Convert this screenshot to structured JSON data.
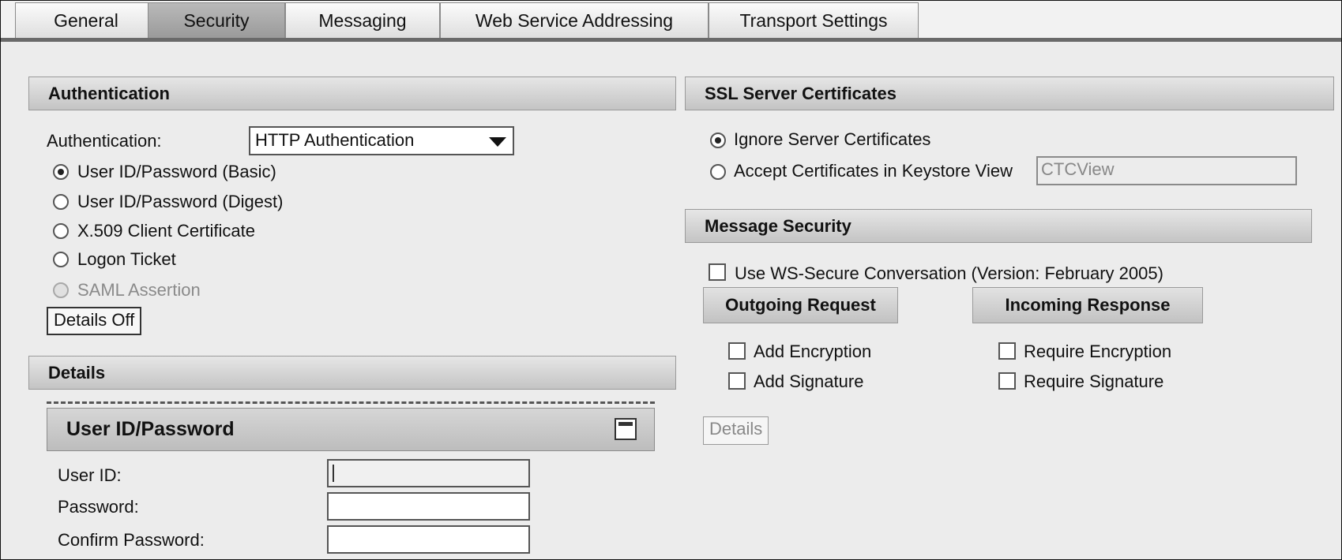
{
  "tabs": [
    "General",
    "Security",
    "Messaging",
    "Web Service Addressing",
    "Transport Settings"
  ],
  "active_tab": "Security",
  "authentication": {
    "section_title": "Authentication",
    "field_label": "Authentication:",
    "selected_value": "HTTP Authentication",
    "options": [
      {
        "label": "User ID/Password (Basic)",
        "checked": true
      },
      {
        "label": "User ID/Password (Digest)",
        "checked": false
      },
      {
        "label": "X.509 Client Certificate",
        "checked": false
      },
      {
        "label": "Logon Ticket",
        "checked": false
      },
      {
        "label": "SAML Assertion",
        "checked": false,
        "disabled": true
      }
    ],
    "details_button": "Details Off"
  },
  "details": {
    "section_title": "Details",
    "tray_title": "User ID/Password",
    "collapse_icon": "collapse-icon",
    "fields": {
      "user_id_label": "User ID:",
      "user_id_value": "",
      "password_label": "Password:",
      "password_value": "",
      "confirm_label": "Confirm Password:",
      "confirm_value": ""
    }
  },
  "ssl": {
    "section_title": "SSL Server Certificates",
    "ignore_label": "Ignore Server Certificates",
    "ignore_checked": true,
    "accept_label": "Accept Certificates in Keystore View",
    "accept_checked": false,
    "keystore_value": "CTCView"
  },
  "message_security": {
    "section_title": "Message Security",
    "ws_secure_label": "Use WS-Secure Conversation (Version: February 2005)",
    "outgoing_title": "Outgoing Request",
    "incoming_title": "Incoming Response",
    "add_encryption": "Add Encryption",
    "add_signature": "Add Signature",
    "require_encryption": "Require Encryption",
    "require_signature": "Require Signature",
    "details_button": "Details"
  },
  "colors": {
    "active_tab": "#a8a8a8",
    "background": "#ececec",
    "tab_underline": "#6a6a6a"
  }
}
